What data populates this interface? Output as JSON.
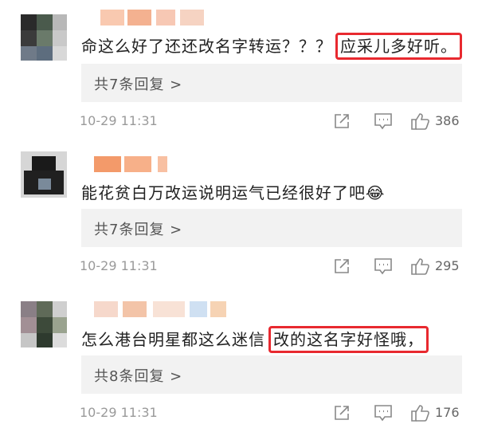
{
  "comments": [
    {
      "text_main": "命这么好了还还改名字转运？？？",
      "text_highlight": "应采儿多好听。",
      "replies_label": "共7条回复 >",
      "time": "10-29 11:31",
      "likes": "386"
    },
    {
      "text_main": "能花贫白万改运说明运气已经很好了吧",
      "emoji": "😂",
      "replies_label": "共7条回复 >",
      "time": "10-29 11:31",
      "likes": "295"
    },
    {
      "text_main": "怎么港台明星都这么迷信",
      "text_highlight": "改的这名字好怪哦，",
      "replies_label": "共8条回复 >",
      "time": "10-29 11:31",
      "likes": "176"
    }
  ],
  "colors": {
    "highlight_border": "#e8292f",
    "reply_bg": "#f2f2f2",
    "meta_text": "#9a9a9a",
    "name_blur": "#f4a07a"
  },
  "icons": [
    "share-icon",
    "comment-icon",
    "thumbs-up-icon"
  ]
}
